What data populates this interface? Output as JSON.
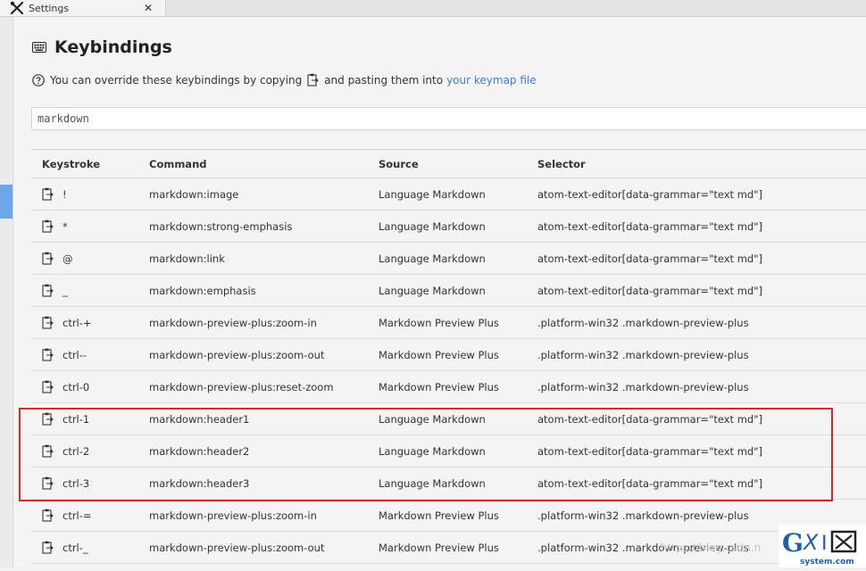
{
  "tab": {
    "title": "Settings",
    "close": "✕"
  },
  "page": {
    "title": "Keybindings",
    "note_before": "You can override these keybindings by copying",
    "note_after": "and pasting them into",
    "note_link": "your keymap file"
  },
  "search": {
    "value": "markdown"
  },
  "table": {
    "headers": {
      "keystroke": "Keystroke",
      "command": "Command",
      "source": "Source",
      "selector": "Selector"
    },
    "rows": [
      {
        "key": "!",
        "command": "markdown:image",
        "source": "Language Markdown",
        "selector": "atom-text-editor[data-grammar=\"text md\"]"
      },
      {
        "key": "*",
        "command": "markdown:strong-emphasis",
        "source": "Language Markdown",
        "selector": "atom-text-editor[data-grammar=\"text md\"]"
      },
      {
        "key": "@",
        "command": "markdown:link",
        "source": "Language Markdown",
        "selector": "atom-text-editor[data-grammar=\"text md\"]"
      },
      {
        "key": "_",
        "command": "markdown:emphasis",
        "source": "Language Markdown",
        "selector": "atom-text-editor[data-grammar=\"text md\"]"
      },
      {
        "key": "ctrl-+",
        "command": "markdown-preview-plus:zoom-in",
        "source": "Markdown Preview Plus",
        "selector": ".platform-win32 .markdown-preview-plus"
      },
      {
        "key": "ctrl--",
        "command": "markdown-preview-plus:zoom-out",
        "source": "Markdown Preview Plus",
        "selector": ".platform-win32 .markdown-preview-plus"
      },
      {
        "key": "ctrl-0",
        "command": "markdown-preview-plus:reset-zoom",
        "source": "Markdown Preview Plus",
        "selector": ".platform-win32 .markdown-preview-plus"
      },
      {
        "key": "ctrl-1",
        "command": "markdown:header1",
        "source": "Language Markdown",
        "selector": "atom-text-editor[data-grammar=\"text md\"]"
      },
      {
        "key": "ctrl-2",
        "command": "markdown:header2",
        "source": "Language Markdown",
        "selector": "atom-text-editor[data-grammar=\"text md\"]"
      },
      {
        "key": "ctrl-3",
        "command": "markdown:header3",
        "source": "Language Markdown",
        "selector": "atom-text-editor[data-grammar=\"text md\"]"
      },
      {
        "key": "ctrl-=",
        "command": "markdown-preview-plus:zoom-in",
        "source": "Markdown Preview Plus",
        "selector": ".platform-win32 .markdown-preview-plus"
      },
      {
        "key": "ctrl-_",
        "command": "markdown-preview-plus:zoom-out",
        "source": "Markdown Preview Plus",
        "selector": ".platform-win32 .markdown-preview-plus"
      }
    ]
  },
  "watermark": "https://blog.csdn.n",
  "colors": {
    "link": "#3b7fd0",
    "highlight": "#d9262c",
    "accent": "#6aa7e9"
  }
}
